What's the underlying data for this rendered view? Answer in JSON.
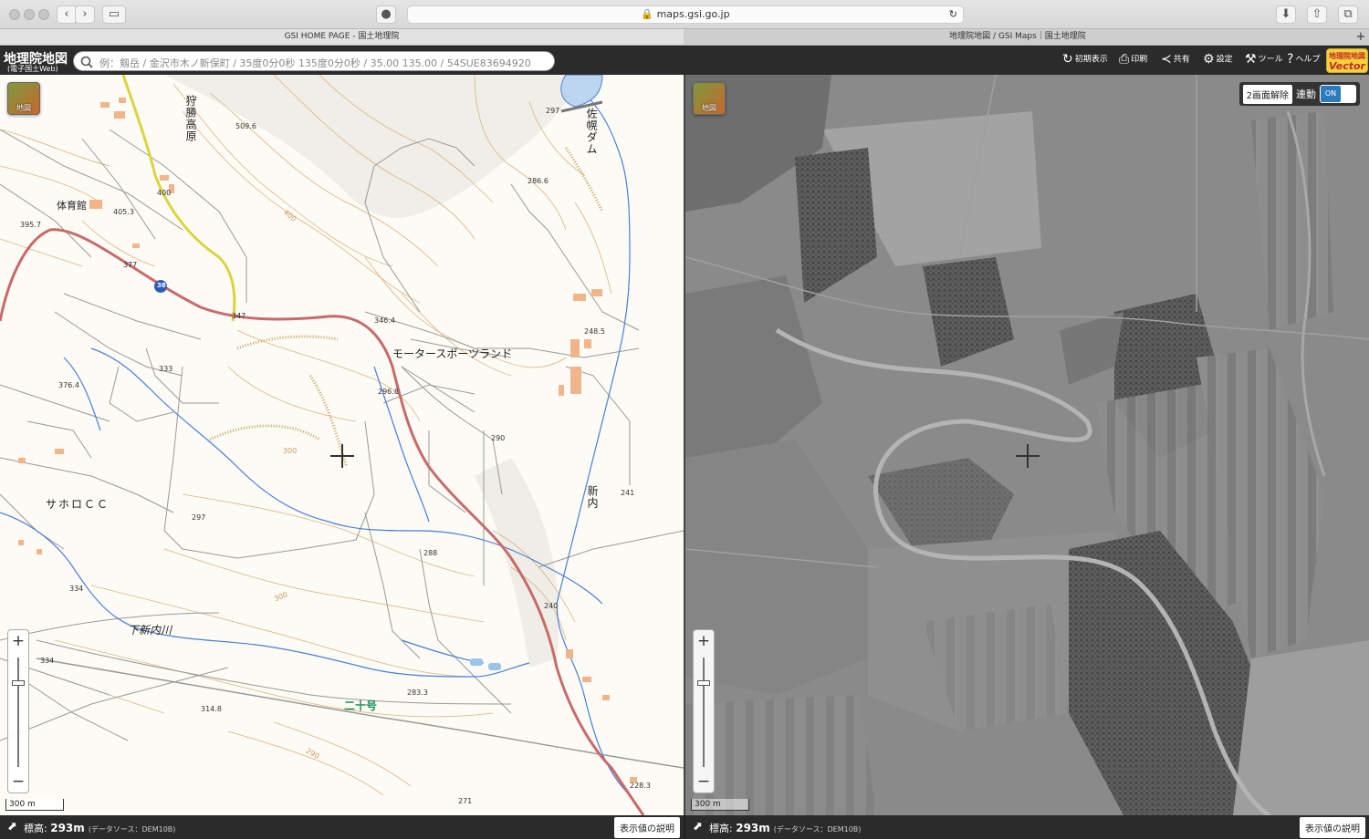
{
  "browser": {
    "url": "maps.gsi.go.jp",
    "tabs": [
      {
        "label": "GSI HOME PAGE - 国土地理院"
      },
      {
        "label": "地理院地図 / GSI Maps｜国土地理院"
      }
    ]
  },
  "header": {
    "logo_title": "地理院地図",
    "logo_subtitle": "(電子国土Web)",
    "search_placeholder": "例：剱岳 / 金沢市木ノ新保町 / 35度0分0秒 135度0分0秒 / 35.00 135.00 / 54SUE83694920",
    "buttons": {
      "reset_view": "初期表示",
      "print": "印刷",
      "share": "共有",
      "settings": "設定",
      "tools": "ツール",
      "help": "ヘルプ"
    },
    "vector_logo_top": "地理院地図",
    "vector_logo_bottom": "Vector"
  },
  "left_map": {
    "layer_button": "地図",
    "labels": {
      "plateau": "狩勝高原",
      "dam": "佐幌ダム",
      "gym": "体育館",
      "motorsport": "モータースポーツランド",
      "golf": "サホロＣＣ",
      "shinnai": "新内",
      "river": "下新内川",
      "road": "二十号"
    },
    "spot_heights": [
      "509.6",
      "405.3",
      "395.7",
      "400",
      "377",
      "347",
      "346.4",
      "333",
      "376.4",
      "296.8",
      "286.6",
      "297",
      "248.5",
      "290",
      "297",
      "288",
      "241",
      "334",
      "334",
      "240",
      "283.3",
      "314.8",
      "228.3",
      "271"
    ],
    "contour_labels": [
      "400",
      "300",
      "300",
      "290"
    ],
    "route_number": "38",
    "scale": "300 m"
  },
  "right_map": {
    "layer_button": "地図",
    "split_button": "2画面解除",
    "sync_label": "連動",
    "toggle_state": "ON",
    "scale": "300 m"
  },
  "footer": {
    "elevation_label": "標高:",
    "elevation_value": "293m",
    "data_source": "(データソース：DEM10B)",
    "explain_button": "表示値の説明"
  },
  "colors": {
    "header_bg": "#2b2b2b",
    "national_route": "#c96a6a",
    "prefectural_road": "#d9d53b",
    "contour": "#e0a86a",
    "river": "#4a7fd6"
  }
}
